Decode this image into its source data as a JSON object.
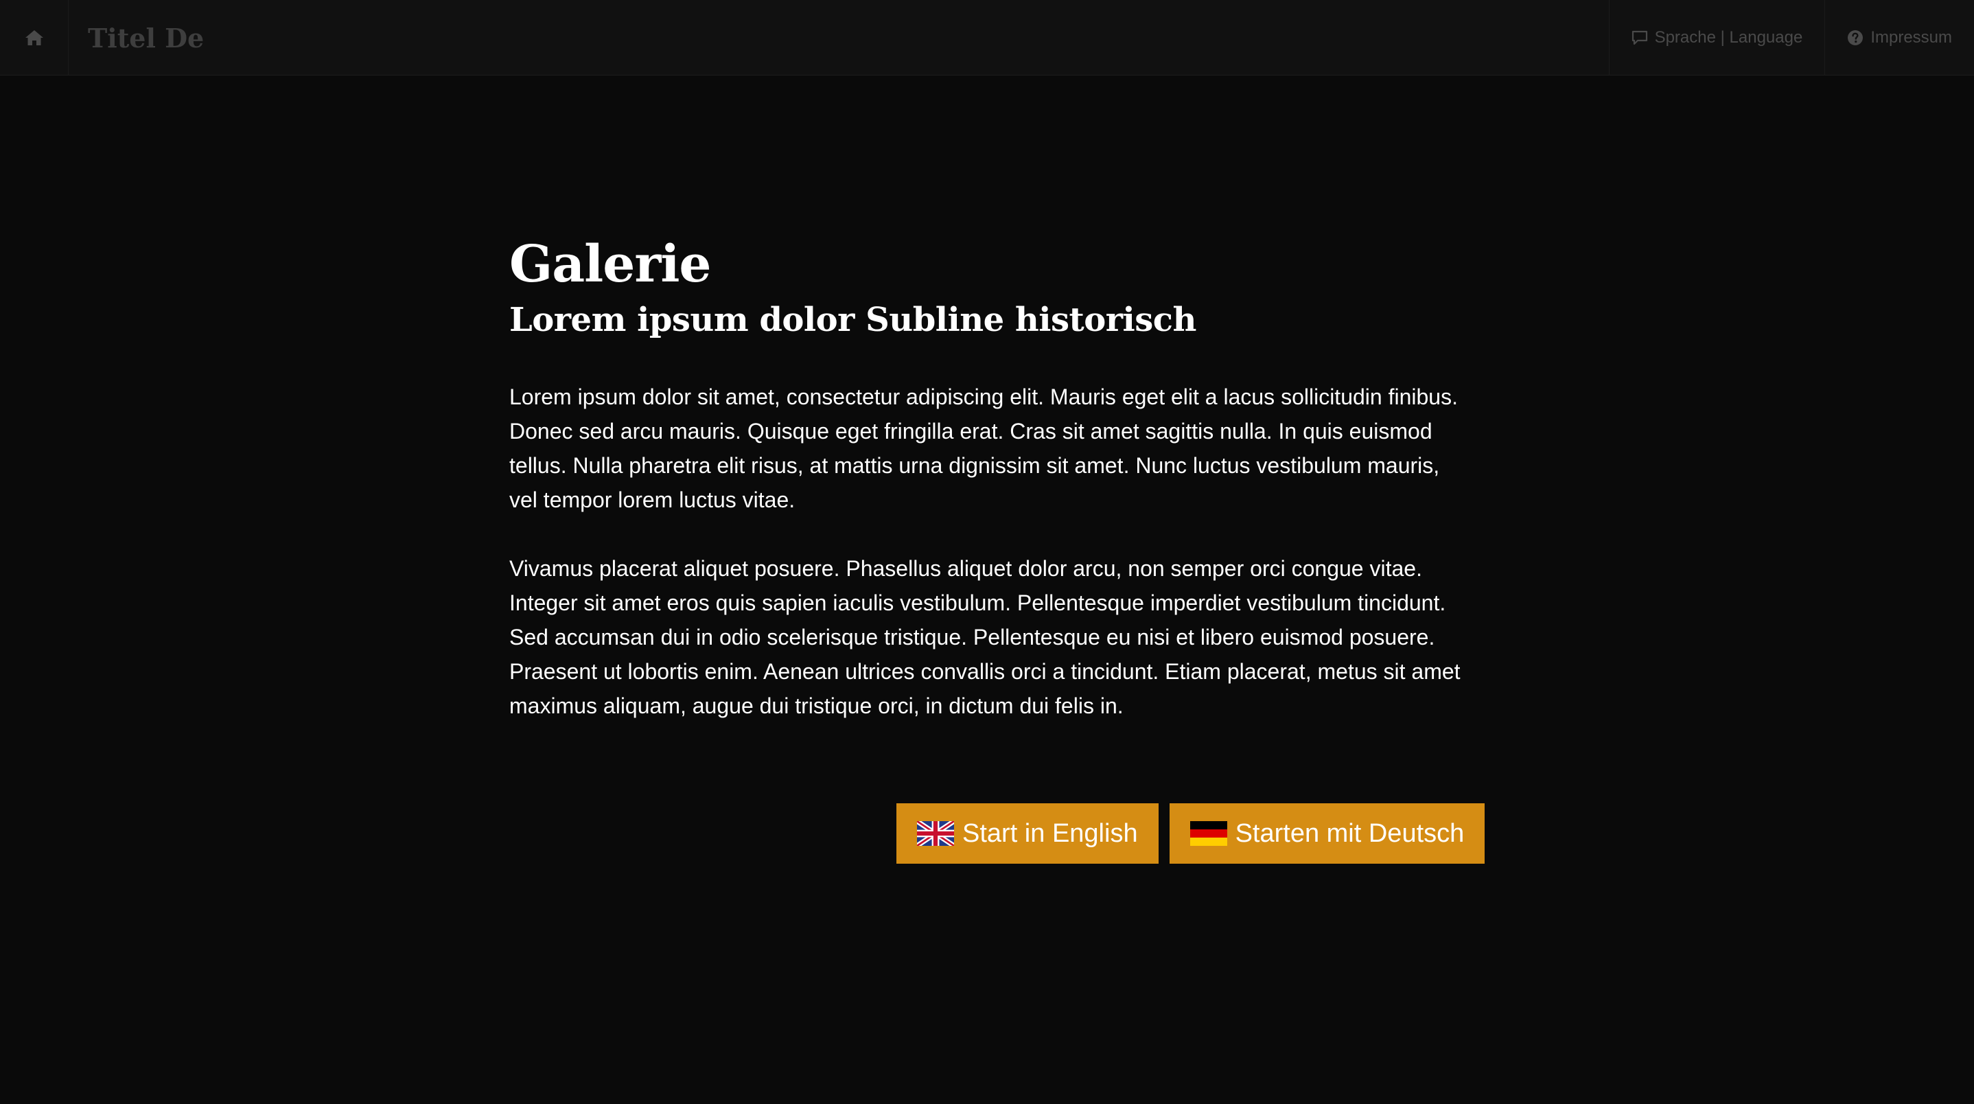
{
  "navbar": {
    "home_icon": "home-icon",
    "title": "Titel De",
    "language_icon": "speech-bubble-icon",
    "language_label": "Sprache | Language",
    "imprint_icon": "question-circle-icon",
    "imprint_label": "Impressum"
  },
  "main": {
    "title": "Galerie",
    "subtitle": "Lorem ipsum dolor Subline historisch",
    "paragraphs": [
      "Lorem ipsum dolor sit amet, consectetur adipiscing elit. Mauris eget elit a lacus sollicitudin finibus. Donec sed arcu mauris. Quisque eget fringilla erat. Cras sit amet sagittis nulla. In quis euismod tellus. Nulla pharetra elit risus, at mattis urna dignissim sit amet. Nunc luctus vestibulum mauris, vel tempor lorem luctus vitae.",
      "Vivamus placerat aliquet posuere. Phasellus aliquet dolor arcu, non semper orci congue vitae. Integer sit amet eros quis sapien iaculis vestibulum. Pellentesque imperdiet vestibulum tincidunt. Sed accumsan dui in odio scelerisque tristique. Pellentesque eu nisi et libero euismod posuere. Praesent ut lobortis enim. Aenean ultrices convallis orci a tincidunt. Etiam placerat, metus sit amet maximus aliquam, augue dui tristique orci, in dictum dui felis in."
    ],
    "buttons": [
      {
        "label": "Start in English",
        "icon": "uk-flag-icon"
      },
      {
        "label": "Starten mit Deutsch",
        "icon": "german-flag-icon"
      }
    ]
  },
  "colors": {
    "background": "#0a0a0a",
    "navbar": "#111111",
    "accent": "#d58d14",
    "text": "#ffffff",
    "nav_text": "#4a4a4a"
  }
}
